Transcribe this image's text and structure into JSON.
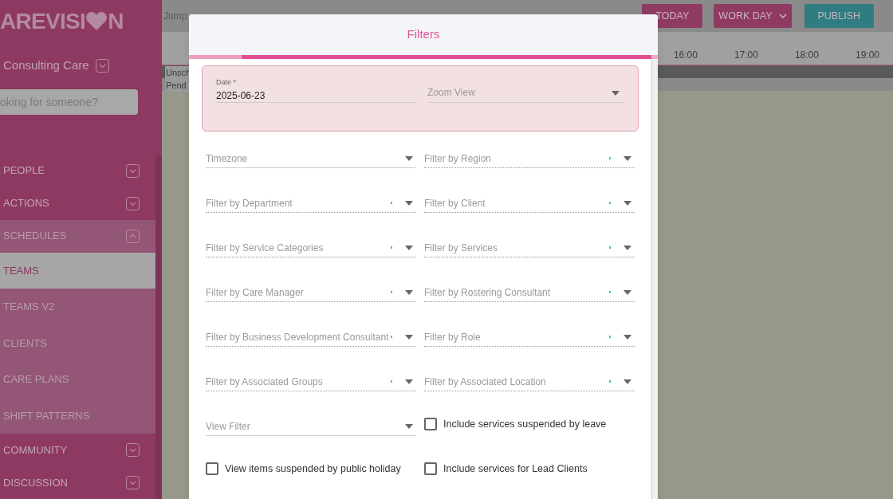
{
  "sidebar": {
    "logo": {
      "before": "AREVISI",
      "after": "N"
    },
    "account": "Consulting Care",
    "search": {
      "placeholder": "oking for someone?"
    },
    "items": [
      {
        "label": "PEOPLE",
        "expanded": false
      },
      {
        "label": "ACTIONS",
        "expanded": false
      },
      {
        "label": "SCHEDULES",
        "expanded": true,
        "children": [
          {
            "label": "TEAMS",
            "selected": true
          },
          {
            "label": "TEAMS V2",
            "selected": false
          },
          {
            "label": "CLIENTS",
            "selected": false
          },
          {
            "label": "CARE PLANS",
            "selected": false
          },
          {
            "label": "SHIFT PATTERNS",
            "selected": false
          }
        ]
      },
      {
        "label": "COMMUNITY",
        "expanded": false
      },
      {
        "label": "DISCUSSION",
        "expanded": false
      }
    ]
  },
  "toolbar": {
    "jump": "Jump",
    "buttons": [
      {
        "label": "TODAY",
        "kind": "plain"
      },
      {
        "label": "WORK DAY",
        "kind": "dropdown"
      },
      {
        "label": "PUBLISH",
        "kind": "publish"
      }
    ]
  },
  "timeline": {
    "hours": [
      "16:00",
      "17:00",
      "18:00",
      "19:00"
    ],
    "rows": [
      "Unsch",
      "Pend"
    ]
  },
  "dialog": {
    "title": "Filters",
    "date": {
      "label": "Date *",
      "value": "2025-06-23"
    },
    "zoom": {
      "placeholder": "Zoom View"
    },
    "fields": [
      {
        "kind": "select",
        "label": "Timezone"
      },
      {
        "kind": "multiselect",
        "label": "Filter by Region"
      },
      {
        "kind": "multiselect",
        "label": "Filter by Department"
      },
      {
        "kind": "multiselect",
        "label": "Filter by Client"
      },
      {
        "kind": "multiselect",
        "label": "Filter by Service Categories"
      },
      {
        "kind": "multiselect",
        "label": "Filter by Services"
      },
      {
        "kind": "multiselect",
        "label": "Filter by Care Manager"
      },
      {
        "kind": "multiselect",
        "label": "Filter by Rostering Consultant"
      },
      {
        "kind": "multiselect",
        "label": "Filter by Business Development Consultant"
      },
      {
        "kind": "multiselect",
        "label": "Filter by Role"
      },
      {
        "kind": "multiselect",
        "label": "Filter by Associated Groups"
      },
      {
        "kind": "multiselect",
        "label": "Filter by Associated Location"
      },
      {
        "kind": "select",
        "label": "View Filter"
      },
      {
        "kind": "checkbox",
        "label": "Include services suspended by leave",
        "checked": false
      },
      {
        "kind": "checkbox",
        "label": "View items suspended by public holiday",
        "checked": false
      },
      {
        "kind": "checkbox",
        "label": "Include services for Lead Clients",
        "checked": false
      }
    ]
  }
}
